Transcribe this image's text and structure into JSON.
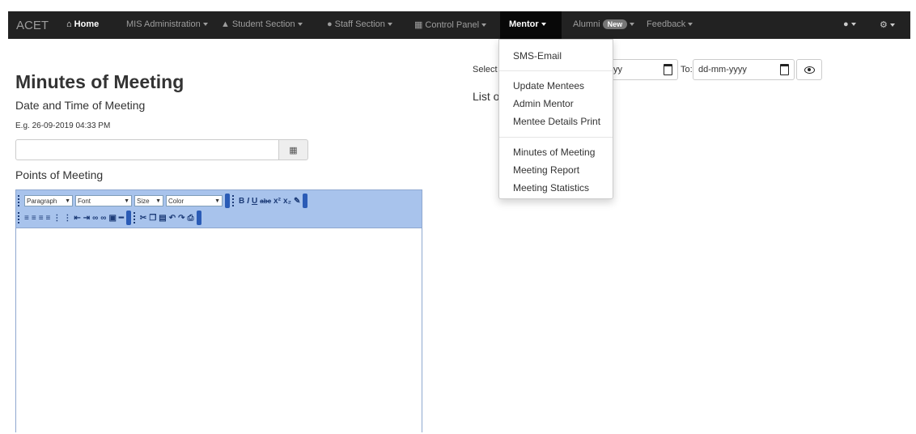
{
  "navbar": {
    "brand": "ACET",
    "items": [
      {
        "label": "Home",
        "icon": "home-icon",
        "caret": false
      },
      {
        "label": "MIS Administration",
        "icon": "",
        "caret": true
      },
      {
        "label": "Student Section",
        "icon": "graduation-cap-icon",
        "caret": true
      },
      {
        "label": "Staff Section",
        "icon": "user-icon",
        "caret": true
      },
      {
        "label": "Control Panel",
        "icon": "grid-icon",
        "caret": true
      },
      {
        "label": "Mentor",
        "icon": "",
        "caret": true
      },
      {
        "label": "Alumni",
        "icon": "",
        "caret": true,
        "badge": "New"
      },
      {
        "label": "Feedback",
        "icon": "",
        "caret": true
      }
    ],
    "right_icons": [
      "user-icon",
      "gear-icon"
    ]
  },
  "mentor_menu": {
    "items": [
      "SMS-Email",
      "Update Mentees",
      "Admin Mentor",
      "Mentee Details Print",
      "Minutes of Meeting",
      "Meeting Report",
      "Meeting Statistics"
    ]
  },
  "form": {
    "title": "Minutes of Meeting",
    "date_label": "Date and Time of Meeting",
    "example": "E.g. 26-09-2019 04:33 PM",
    "date_value": "",
    "points_label": "Points of Meeting"
  },
  "editor": {
    "paragraph": "Paragraph",
    "font": "Font",
    "size": "Size",
    "color": "Color"
  },
  "filter": {
    "select_label": "Select",
    "from_value": "yyyy",
    "to_label": "To:",
    "to_value": "dd-mm-yyyy",
    "list_title": "List o"
  },
  "colors": {
    "navbar": "#222222",
    "toolbar": "#a8c3ec",
    "badge": "#777777"
  }
}
